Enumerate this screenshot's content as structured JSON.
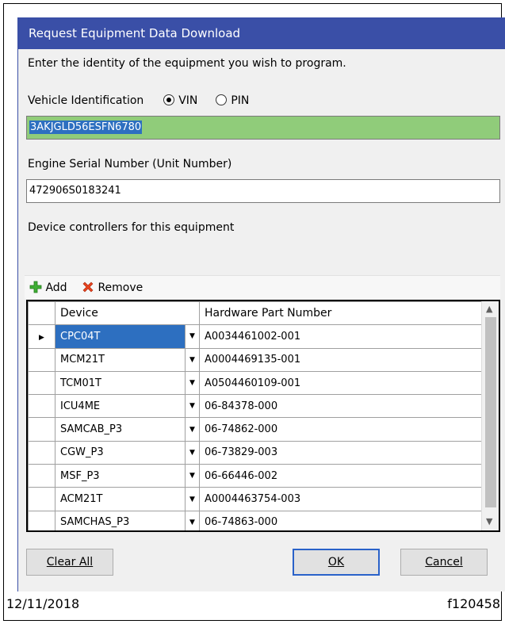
{
  "dialog": {
    "title": "Request Equipment Data Download",
    "instruction": "Enter the identity of the equipment you wish to program.",
    "vehicle_id": {
      "label": "Vehicle Identification",
      "options": [
        "VIN",
        "PIN"
      ],
      "selected": "VIN",
      "value": "3AKJGLD56ESFN6780"
    },
    "engine_serial": {
      "label": "Engine Serial Number (Unit Number)",
      "value": "472906S0183241"
    },
    "devices_label": "Device controllers for this equipment",
    "toolbar": {
      "add_label": "Add",
      "remove_label": "Remove"
    },
    "grid": {
      "columns": [
        "Device",
        "Hardware Part Number"
      ],
      "selected_row": 0,
      "rows": [
        {
          "device": "CPC04T",
          "part_number": "A0034461002-001"
        },
        {
          "device": "MCM21T",
          "part_number": "A0004469135-001"
        },
        {
          "device": "TCM01T",
          "part_number": "A0504460109-001"
        },
        {
          "device": "ICU4ME",
          "part_number": "06-84378-000"
        },
        {
          "device": "SAMCAB_P3",
          "part_number": "06-74862-000"
        },
        {
          "device": "CGW_P3",
          "part_number": "06-73829-003"
        },
        {
          "device": "MSF_P3",
          "part_number": "06-66446-002"
        },
        {
          "device": "ACM21T",
          "part_number": "A0004463754-003"
        },
        {
          "device": "SAMCHAS_P3",
          "part_number": "06-74863-000"
        }
      ]
    },
    "buttons": {
      "clear_all": "Clear All",
      "ok": "OK",
      "cancel": "Cancel"
    }
  },
  "footer": {
    "date": "12/11/2018",
    "figure_id": "f120458"
  },
  "colors": {
    "title_bar": "#3a4fa7",
    "vin_field": "#90cc7a",
    "selection": "#2d6fc0"
  }
}
